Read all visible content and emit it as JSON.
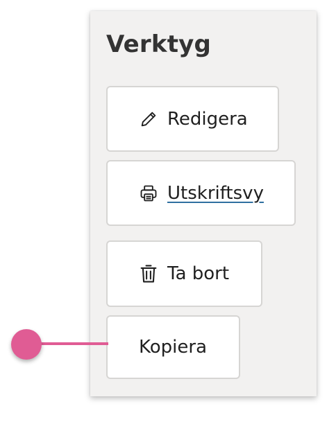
{
  "panel": {
    "title": "Verktyg",
    "background": "#f2f1f0"
  },
  "tools": [
    {
      "label": "Redigera",
      "icon": "pencil-icon"
    },
    {
      "label": "Utskriftsvy",
      "icon": "printer-icon",
      "underlined": true
    },
    {
      "label": "Ta bort",
      "icon": "trash-icon"
    },
    {
      "label": "Kopiera",
      "icon": null,
      "highlighted": true
    }
  ],
  "accent": {
    "marker_color": "#e05c94",
    "underline_color": "#2f6fa0"
  }
}
